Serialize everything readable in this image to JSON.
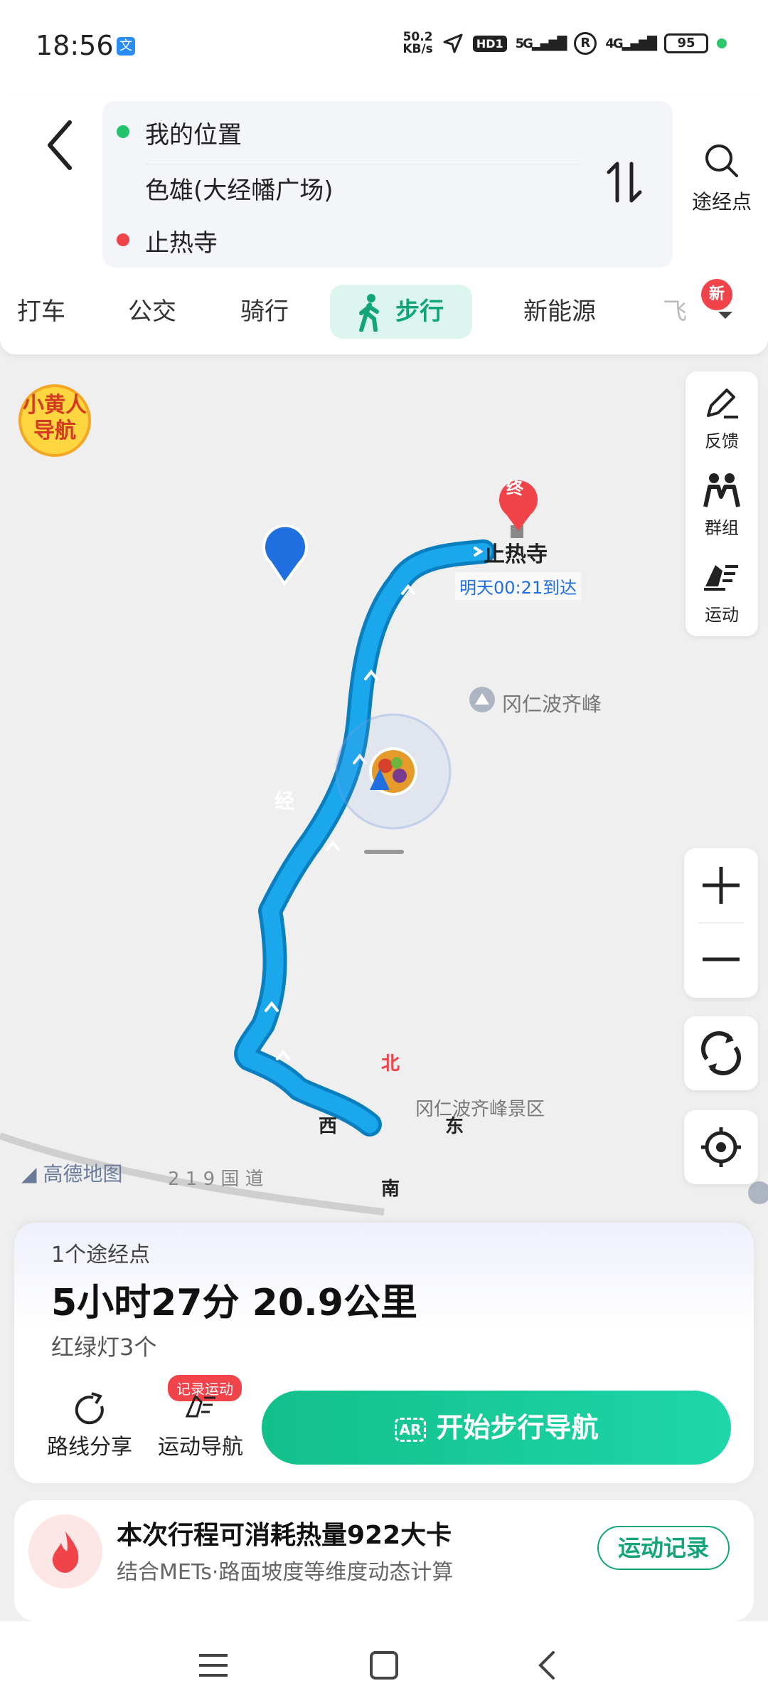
{
  "status": {
    "time": "18:56",
    "app_icon": "文",
    "speed_value": "50.2",
    "speed_unit": "KB/s",
    "hd": "HD1",
    "net1": "5G",
    "net2": "4G",
    "battery": "95"
  },
  "route": {
    "origin": "我的位置",
    "waypoint": "色雄(大经幡广场)",
    "destination": "止热寺"
  },
  "waypoint_button": {
    "label": "途经点"
  },
  "tabs": [
    {
      "label": "打车"
    },
    {
      "label": "公交"
    },
    {
      "label": "骑行"
    },
    {
      "label": "步行"
    },
    {
      "label": "新能源"
    }
  ],
  "tab_badge": "新",
  "map": {
    "brand_text": "小黄人导航",
    "end_marker": "终",
    "destination_label": "止热寺",
    "arrival": "明天00:21到达",
    "poi_peak": "冈仁波齐峰",
    "waypoint_marker": "经",
    "poi_scenic": "冈仁波齐峰景区",
    "compass": {
      "north": "北",
      "south": "南",
      "east": "东",
      "west": "西"
    },
    "road": "2 1 9 国 道",
    "logo": "高德地图"
  },
  "side_panel": [
    {
      "label": "反馈",
      "icon": "edit-icon"
    },
    {
      "label": "群组",
      "icon": "group-icon"
    },
    {
      "label": "运动",
      "icon": "running-icon"
    }
  ],
  "sheet": {
    "waypoints": "1个途经点",
    "summary": "5小时27分 20.9公里",
    "lights": "红绿灯3个",
    "share": "路线分享",
    "sport_nav": "运动导航",
    "record_badge": "记录运动",
    "start": "开始步行导航"
  },
  "calorie": {
    "title": "本次行程可消耗热量922大卡",
    "subtitle": "结合METs·路面坡度等维度动态计算",
    "button": "运动记录"
  },
  "colors": {
    "accent": "#13a57a",
    "route": "#1aa7ec",
    "red": "#f0434a"
  }
}
